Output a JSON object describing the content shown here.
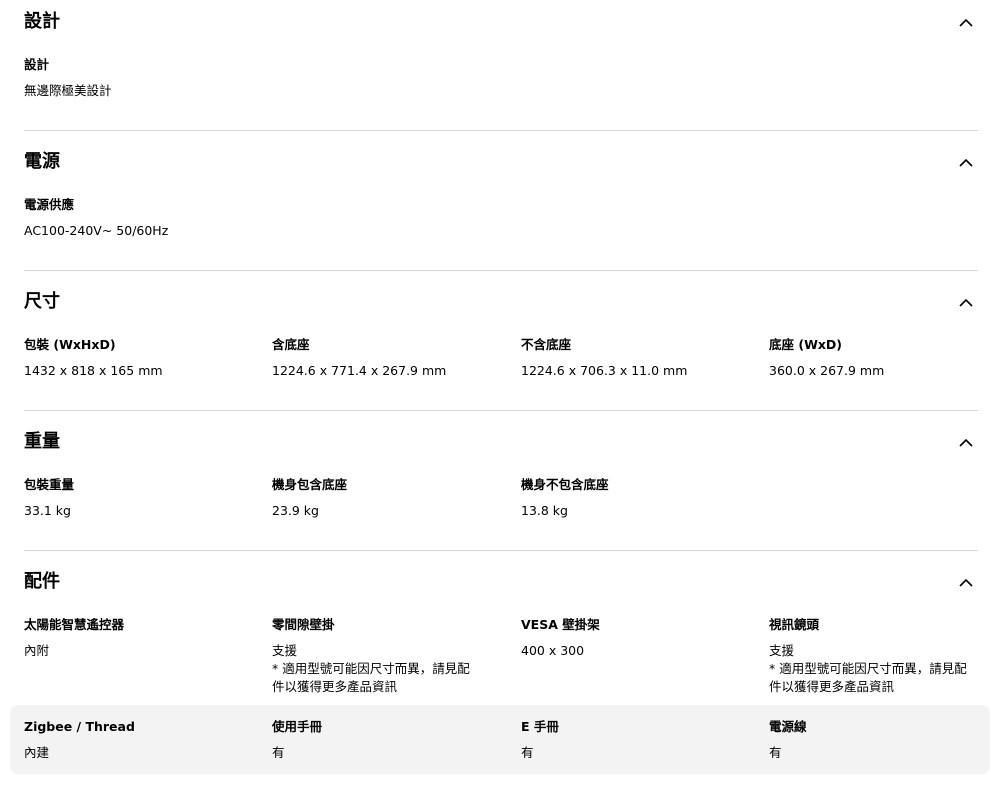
{
  "sections": [
    {
      "title": "設計",
      "specs": [
        {
          "label": "設計",
          "value": "無邊際極美設計"
        }
      ]
    },
    {
      "title": "電源",
      "specs": [
        {
          "label": "電源供應",
          "value": "AC100-240V~ 50/60Hz"
        }
      ]
    },
    {
      "title": "尺寸",
      "specs": [
        {
          "label": "包裝 (WxHxD)",
          "value": "1432 x 818 x 165 mm"
        },
        {
          "label": "含底座",
          "value": "1224.6 x 771.4 x 267.9 mm"
        },
        {
          "label": "不含底座",
          "value": "1224.6 x 706.3 x 11.0 mm"
        },
        {
          "label": "底座 (WxD)",
          "value": "360.0 x 267.9 mm"
        }
      ]
    },
    {
      "title": "重量",
      "specs": [
        {
          "label": "包裝重量",
          "value": "33.1 kg"
        },
        {
          "label": "機身包含底座",
          "value": "23.9 kg"
        },
        {
          "label": "機身不包含底座",
          "value": "13.8 kg"
        }
      ]
    },
    {
      "title": "配件",
      "specs": [
        {
          "label": "太陽能智慧遙控器",
          "value": "內附"
        },
        {
          "label": "零間隙壁掛",
          "value": "支援",
          "note1": "* 適用型號可能因尺寸而異，請見配",
          "note2": "件以獲得更多產品資訊"
        },
        {
          "label": "VESA 壁掛架",
          "value": "400 x 300"
        },
        {
          "label": "視訊鏡頭",
          "value": "支援",
          "note1": "* 適用型號可能因尺寸而異，請見配",
          "note2": "件以獲得更多產品資訊"
        },
        {
          "label": "Zigbee / Thread",
          "value": "內建"
        },
        {
          "label": "使用手冊",
          "value": "有"
        },
        {
          "label": "E 手冊",
          "value": "有"
        },
        {
          "label": "電源線",
          "value": "有"
        }
      ]
    }
  ]
}
